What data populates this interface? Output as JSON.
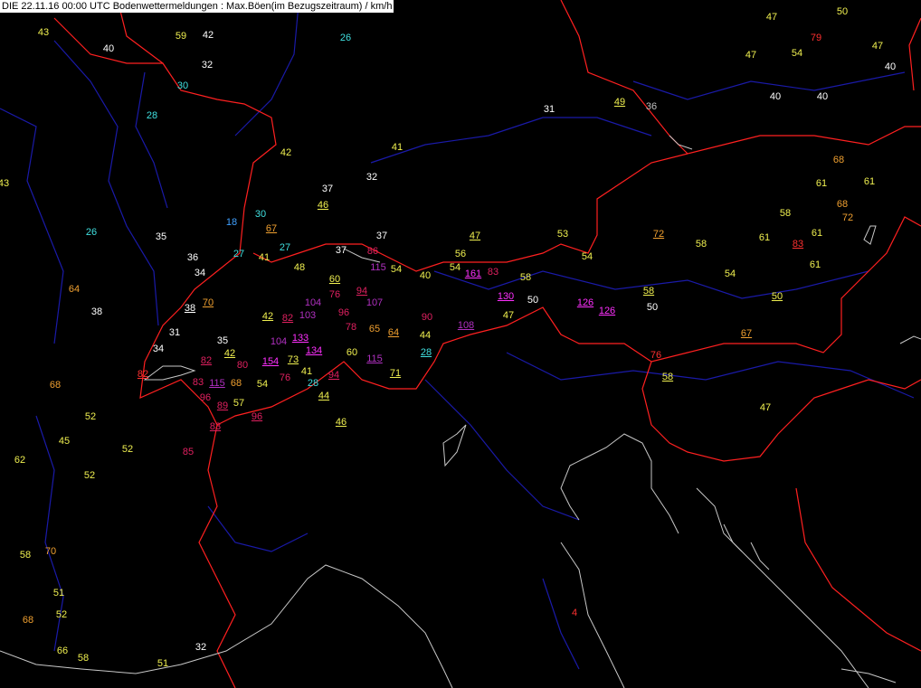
{
  "title": "DIE 22.11.16 00:00 UTC  Bodenwettermeldungen :  Max.Böen(im Bezugszeitraum) / km/h",
  "colors": {
    "background": "#000000",
    "border": "#ff2020",
    "river": "#1a1aa8",
    "coast": "#c8c8c8",
    "white": "#ffffff",
    "cyan": "#40e0e0",
    "blue": "#40a0ff",
    "yellow": "#f0f050",
    "orange": "#f0a030",
    "red": "#ff3030",
    "crimson": "#e02060",
    "purple": "#b030c0",
    "magenta": "#ff30ff",
    "gray": "#c0c0c0"
  },
  "stations": [
    {
      "v": "43",
      "c": "yellow"
    },
    {
      "v": "40",
      "c": "white"
    },
    {
      "v": "59",
      "c": "yellow"
    },
    {
      "v": "42",
      "c": "white"
    },
    {
      "v": "32",
      "c": "white"
    },
    {
      "v": "26",
      "c": "cyan"
    },
    {
      "v": "30",
      "c": "cyan"
    },
    {
      "v": "28",
      "c": "cyan"
    },
    {
      "v": "42",
      "c": "yellow"
    },
    {
      "v": "41",
      "c": "yellow"
    },
    {
      "v": "32",
      "c": "white"
    },
    {
      "v": "37",
      "c": "white"
    },
    {
      "v": "46",
      "c": "yellow",
      "u": true
    },
    {
      "v": "43",
      "c": "yellow"
    },
    {
      "v": "26",
      "c": "cyan"
    },
    {
      "v": "35",
      "c": "white"
    },
    {
      "v": "18",
      "c": "blue"
    },
    {
      "v": "30",
      "c": "cyan"
    },
    {
      "v": "67",
      "c": "orange",
      "u": true
    },
    {
      "v": "27",
      "c": "cyan"
    },
    {
      "v": "27",
      "c": "cyan"
    },
    {
      "v": "41",
      "c": "yellow"
    },
    {
      "v": "36",
      "c": "white"
    },
    {
      "v": "34",
      "c": "white"
    },
    {
      "v": "48",
      "c": "yellow"
    },
    {
      "v": "37",
      "c": "white"
    },
    {
      "v": "37",
      "c": "white"
    },
    {
      "v": "86",
      "c": "crimson"
    },
    {
      "v": "115",
      "c": "purple"
    },
    {
      "v": "54",
      "c": "yellow"
    },
    {
      "v": "40",
      "c": "yellow"
    },
    {
      "v": "56",
      "c": "yellow"
    },
    {
      "v": "47",
      "c": "yellow",
      "u": true
    },
    {
      "v": "54",
      "c": "yellow"
    },
    {
      "v": "161",
      "c": "magenta",
      "u": true
    },
    {
      "v": "83",
      "c": "crimson"
    },
    {
      "v": "53",
      "c": "yellow"
    },
    {
      "v": "54",
      "c": "yellow"
    },
    {
      "v": "58",
      "c": "yellow"
    },
    {
      "v": "64",
      "c": "orange"
    },
    {
      "v": "38",
      "c": "white"
    },
    {
      "v": "38",
      "c": "white",
      "u": true
    },
    {
      "v": "70",
      "c": "orange",
      "u": true
    },
    {
      "v": "60",
      "c": "yellow",
      "u": true
    },
    {
      "v": "76",
      "c": "crimson"
    },
    {
      "v": "94",
      "c": "crimson",
      "u": true
    },
    {
      "v": "104",
      "c": "purple"
    },
    {
      "v": "107",
      "c": "purple"
    },
    {
      "v": "96",
      "c": "crimson"
    },
    {
      "v": "42",
      "c": "yellow",
      "u": true
    },
    {
      "v": "82",
      "c": "crimson",
      "u": true
    },
    {
      "v": "103",
      "c": "purple"
    },
    {
      "v": "90",
      "c": "crimson"
    },
    {
      "v": "130",
      "c": "magenta",
      "u": true
    },
    {
      "v": "50",
      "c": "white"
    },
    {
      "v": "47",
      "c": "yellow"
    },
    {
      "v": "108",
      "c": "purple",
      "u": true
    },
    {
      "v": "126",
      "c": "magenta",
      "u": true
    },
    {
      "v": "126",
      "c": "magenta",
      "u": true
    },
    {
      "v": "31",
      "c": "white"
    },
    {
      "v": "78",
      "c": "crimson"
    },
    {
      "v": "65",
      "c": "orange"
    },
    {
      "v": "64",
      "c": "orange",
      "u": true
    },
    {
      "v": "44",
      "c": "yellow"
    },
    {
      "v": "35",
      "c": "white"
    },
    {
      "v": "104",
      "c": "purple"
    },
    {
      "v": "133",
      "c": "magenta",
      "u": true
    },
    {
      "v": "34",
      "c": "white"
    },
    {
      "v": "42",
      "c": "yellow",
      "u": true
    },
    {
      "v": "134",
      "c": "magenta",
      "u": true
    },
    {
      "v": "60",
      "c": "yellow"
    },
    {
      "v": "28",
      "c": "cyan",
      "u": true
    },
    {
      "v": "82",
      "c": "crimson",
      "u": true
    },
    {
      "v": "80",
      "c": "crimson"
    },
    {
      "v": "154",
      "c": "magenta",
      "u": true
    },
    {
      "v": "73",
      "c": "yellow",
      "u": true
    },
    {
      "v": "115",
      "c": "purple",
      "u": true
    },
    {
      "v": "82",
      "c": "red",
      "u": true
    },
    {
      "v": "41",
      "c": "yellow"
    },
    {
      "v": "94",
      "c": "crimson",
      "u": true
    },
    {
      "v": "71",
      "c": "yellow",
      "u": true
    },
    {
      "v": "28",
      "c": "cyan"
    },
    {
      "v": "83",
      "c": "crimson"
    },
    {
      "v": "115",
      "c": "purple",
      "u": true
    },
    {
      "v": "68",
      "c": "orange"
    },
    {
      "v": "54",
      "c": "yellow"
    },
    {
      "v": "76",
      "c": "crimson"
    },
    {
      "v": "96",
      "c": "crimson"
    },
    {
      "v": "44",
      "c": "yellow",
      "u": true
    },
    {
      "v": "68",
      "c": "orange"
    },
    {
      "v": "89",
      "c": "crimson",
      "u": true
    },
    {
      "v": "57",
      "c": "yellow"
    },
    {
      "v": "96",
      "c": "crimson",
      "u": true
    },
    {
      "v": "83",
      "c": "crimson",
      "u": true
    },
    {
      "v": "46",
      "c": "yellow",
      "u": true
    },
    {
      "v": "52",
      "c": "yellow"
    },
    {
      "v": "45",
      "c": "yellow"
    },
    {
      "v": "52",
      "c": "yellow"
    },
    {
      "v": "85",
      "c": "crimson"
    },
    {
      "v": "62",
      "c": "yellow"
    },
    {
      "v": "52",
      "c": "yellow"
    },
    {
      "v": "58",
      "c": "yellow"
    },
    {
      "v": "70",
      "c": "orange"
    },
    {
      "v": "51",
      "c": "yellow"
    },
    {
      "v": "68",
      "c": "orange"
    },
    {
      "v": "52",
      "c": "yellow"
    },
    {
      "v": "66",
      "c": "yellow"
    },
    {
      "v": "58",
      "c": "yellow"
    },
    {
      "v": "32",
      "c": "white"
    },
    {
      "v": "51",
      "c": "yellow"
    },
    {
      "v": "31",
      "c": "white"
    },
    {
      "v": "49",
      "c": "yellow",
      "u": true
    },
    {
      "v": "36",
      "c": "gray"
    },
    {
      "v": "47",
      "c": "yellow"
    },
    {
      "v": "50",
      "c": "yellow"
    },
    {
      "v": "79",
      "c": "red"
    },
    {
      "v": "47",
      "c": "yellow"
    },
    {
      "v": "54",
      "c": "yellow"
    },
    {
      "v": "47",
      "c": "yellow"
    },
    {
      "v": "40",
      "c": "white"
    },
    {
      "v": "40",
      "c": "white"
    },
    {
      "v": "40",
      "c": "white"
    },
    {
      "v": "68",
      "c": "orange"
    },
    {
      "v": "61",
      "c": "yellow"
    },
    {
      "v": "61",
      "c": "yellow"
    },
    {
      "v": "68",
      "c": "orange"
    },
    {
      "v": "72",
      "c": "orange"
    },
    {
      "v": "58",
      "c": "yellow"
    },
    {
      "v": "72",
      "c": "orange",
      "u": true
    },
    {
      "v": "58",
      "c": "yellow"
    },
    {
      "v": "61",
      "c": "yellow"
    },
    {
      "v": "83",
      "c": "red",
      "u": true
    },
    {
      "v": "61",
      "c": "yellow"
    },
    {
      "v": "61",
      "c": "yellow"
    },
    {
      "v": "54",
      "c": "yellow"
    },
    {
      "v": "58",
      "c": "yellow",
      "u": true
    },
    {
      "v": "50",
      "c": "white"
    },
    {
      "v": "50",
      "c": "yellow",
      "u": true
    },
    {
      "v": "67",
      "c": "orange",
      "u": true
    },
    {
      "v": "76",
      "c": "red"
    },
    {
      "v": "58",
      "c": "yellow",
      "u": true
    },
    {
      "v": "47",
      "c": "yellow"
    },
    {
      "v": "4",
      "c": "red"
    }
  ]
}
